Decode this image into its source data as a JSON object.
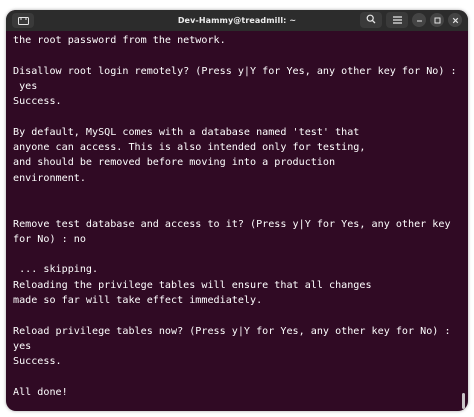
{
  "window": {
    "title": "Dev-Hammy@treadmill: ~"
  },
  "titlebar": {
    "new_tab_icon": "new-tab-icon",
    "search_icon": "search-icon",
    "menu_icon": "hamburger-menu-icon",
    "minimize_icon": "minimize-icon",
    "maximize_icon": "maximize-icon",
    "close_icon": "close-icon"
  },
  "colors": {
    "terminal_bg": "#300a24",
    "titlebar_bg": "#2c2c2c",
    "text": "#ffffff"
  },
  "terminal": {
    "lines": [
      "the root password from the network.",
      "",
      "Disallow root login remotely? (Press y|Y for Yes, any other key for No) :",
      " yes",
      "Success.",
      "",
      "By default, MySQL comes with a database named 'test' that",
      "anyone can access. This is also intended only for testing,",
      "and should be removed before moving into a production",
      "environment.",
      "",
      "",
      "Remove test database and access to it? (Press y|Y for Yes, any other key",
      "for No) : no",
      "",
      " ... skipping.",
      "Reloading the privilege tables will ensure that all changes",
      "made so far will take effect immediately.",
      "",
      "Reload privilege tables now? (Press y|Y for Yes, any other key for No) :",
      "yes",
      "Success.",
      "",
      "All done!"
    ]
  }
}
